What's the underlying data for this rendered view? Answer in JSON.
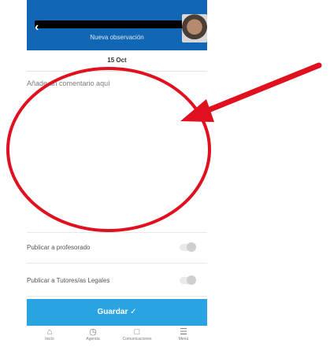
{
  "header": {
    "subtitle": "Nueva observación",
    "back_icon": "chevron-left-icon",
    "avatar": "avatar-photo"
  },
  "date_label": "15 Oct",
  "comment": {
    "placeholder": "Añade un comentario aquí"
  },
  "toggles": [
    {
      "label": "Publicar a profesorado",
      "on": false
    },
    {
      "label": "Publicar a Tutores/as Legales",
      "on": false
    }
  ],
  "save_button": {
    "label": "Guardar",
    "icon": "check-icon"
  },
  "tabs": [
    {
      "label": "Inicio",
      "icon": "home-icon"
    },
    {
      "label": "Agenda",
      "icon": "clock-icon"
    },
    {
      "label": "Comunicaciones",
      "icon": "chat-icon"
    },
    {
      "label": "Menú",
      "icon": "menu-icon"
    }
  ],
  "colors": {
    "header": "#1167b3",
    "save": "#2aa3e3",
    "annotation": "#e0101f"
  }
}
